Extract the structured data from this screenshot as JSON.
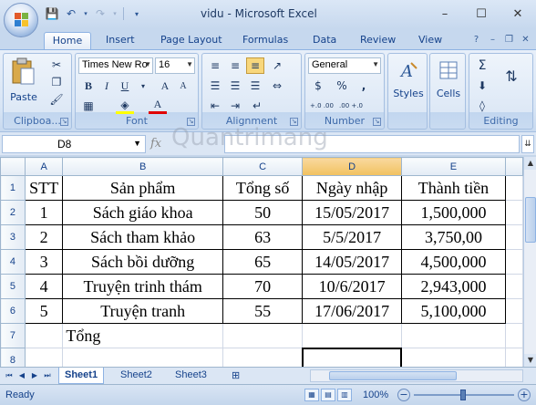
{
  "window": {
    "title": "vidu - Microsoft Excel",
    "minimize": "–",
    "maximize": "☐",
    "close": "✕"
  },
  "tabs": [
    "Home",
    "Insert",
    "Page Layout",
    "Formulas",
    "Data",
    "Review",
    "View"
  ],
  "ribbon": {
    "clipboard": {
      "label": "Clipboa...",
      "paste": "Paste"
    },
    "font": {
      "label": "Font",
      "name": "Times New Ro",
      "size": "16",
      "bold": "B",
      "italic": "I",
      "underline": "U",
      "grow": "A",
      "shrink": "A",
      "fontcolor": "A"
    },
    "alignment": {
      "label": "Alignment"
    },
    "number": {
      "label": "Number",
      "format": "General",
      "currency": "$",
      "percent": "%",
      "comma": ",",
      "inc_decimal": "+.0 .00",
      "dec_decimal": ".00 +.0"
    },
    "styles": {
      "label": "Styles"
    },
    "cells": {
      "label": "Cells"
    },
    "editing": {
      "label": "Editing",
      "sum": "Σ"
    }
  },
  "formula_bar": {
    "name_box": "D8",
    "fx": "fx",
    "value": ""
  },
  "columns": [
    "A",
    "B",
    "C",
    "D",
    "E"
  ],
  "rows": [
    [
      "STT",
      "Sản phẩm",
      "Tổng số",
      "Ngày nhập",
      "Thành tiền"
    ],
    [
      "1",
      "Sách giáo khoa",
      "50",
      "15/05/2017",
      "1,500,000"
    ],
    [
      "2",
      "Sách tham khảo",
      "63",
      "5/5/2017",
      "3,750,00"
    ],
    [
      "3",
      "Sách bồi dưỡng",
      "65",
      "14/05/2017",
      "4,500,000"
    ],
    [
      "4",
      "Truyện trinh thám",
      "70",
      "10/6/2017",
      "2,943,000"
    ],
    [
      "5",
      "Truyện tranh",
      "55",
      "17/06/2017",
      "5,100,000"
    ],
    [
      "",
      "Tổng",
      "",
      "",
      ""
    ],
    [
      "",
      "",
      "",
      "",
      ""
    ]
  ],
  "row_numbers": [
    "1",
    "2",
    "3",
    "4",
    "5",
    "6",
    "7",
    "8"
  ],
  "sheets": [
    "Sheet1",
    "Sheet2",
    "Sheet3"
  ],
  "status": {
    "ready": "Ready",
    "zoom": "100%",
    "zoom_minus": "−",
    "zoom_plus": "+"
  },
  "watermark": "Quantrimang",
  "colors": {
    "accent": "#15428b",
    "ribbon_bg": "#dbe6f4",
    "selected_col": "#f1c15f"
  }
}
